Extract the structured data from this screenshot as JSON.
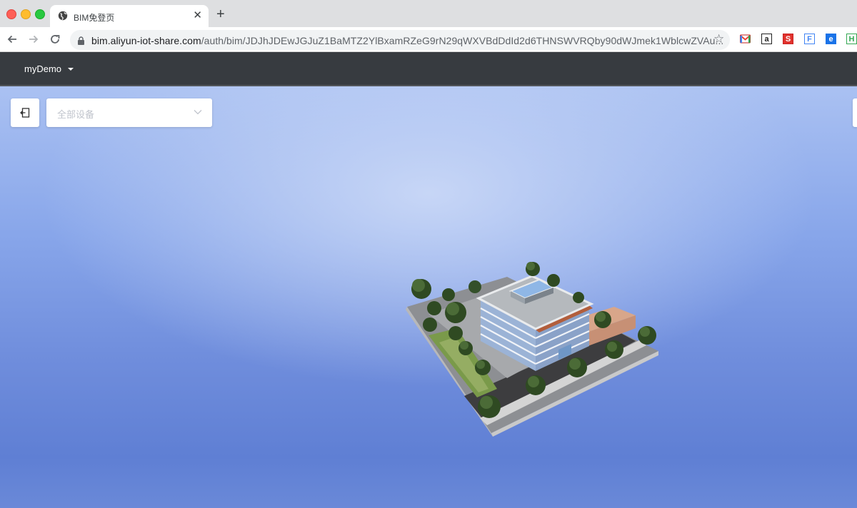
{
  "browser": {
    "tab_title": "BIM免登页",
    "tab_close": "✕",
    "new_tab": "+",
    "url_host": "bim.aliyun-iot-share.com",
    "url_path": "/auth/bim/JDJhJDEwJGJuZ1BaMTZ2YlBxamRZeG9rN29qWXVBdDdId2d6THNSWVRQby90dWJmek1WblcwZVAu...",
    "star": "☆",
    "extensions": [
      {
        "icon": "gmail-icon"
      },
      {
        "icon": "a-icon",
        "label": "a"
      },
      {
        "icon": "s-icon",
        "label": "S"
      },
      {
        "icon": "f-icon",
        "label": "F"
      },
      {
        "icon": "e-icon",
        "label": "e"
      },
      {
        "icon": "h-icon",
        "label": "H"
      }
    ]
  },
  "app": {
    "project_name": "myDemo"
  },
  "controls": {
    "device_filter_placeholder": "全部设备"
  },
  "scene": {
    "object": "building-model"
  }
}
